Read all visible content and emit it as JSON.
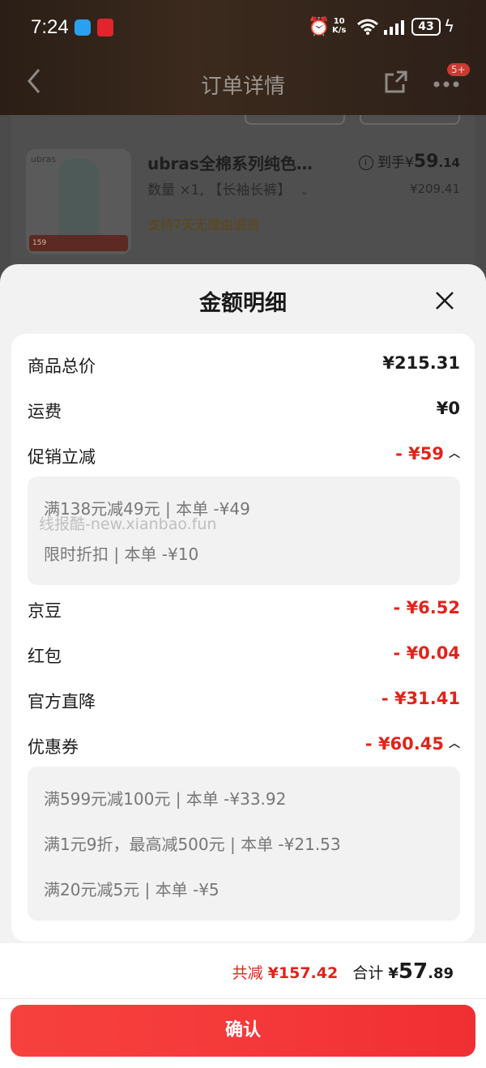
{
  "status_bar": {
    "time": "7:24",
    "speed_top": "10",
    "speed_bottom": "K/s",
    "battery": "43"
  },
  "nav": {
    "title": "订单详情",
    "badge": "5+"
  },
  "product": {
    "brand": "ubras",
    "name": "ubras全棉系列纯色…",
    "quantity": "数量 ×1, 【长袖长裤】",
    "return_policy": "支持7天无理由退货",
    "price_label": "到手¥",
    "price_int": "59",
    "price_dec": ".14",
    "original_price": "¥209.41",
    "thumb_promo": "159"
  },
  "sheet": {
    "title": "金额明细",
    "rows": [
      {
        "label": "商品总价",
        "value": "¥215.31"
      },
      {
        "label": "运费",
        "value": "¥0"
      },
      {
        "label": "促销立减",
        "value": "- ¥59"
      },
      {
        "label": "京豆",
        "value": "- ¥6.52"
      },
      {
        "label": "红包",
        "value": "- ¥0.04"
      },
      {
        "label": "官方直降",
        "value": "- ¥31.41"
      },
      {
        "label": "优惠券",
        "value": "- ¥60.45"
      }
    ],
    "promo_details": [
      "满138元减49元 | 本单 -¥49",
      "限时折扣 | 本单 -¥10"
    ],
    "coupon_details": [
      "满599元减100元 | 本单 -¥33.92",
      "满1元9折，最高减500元 | 本单 -¥21.53",
      "满20元减5元 | 本单 -¥5"
    ],
    "watermark": "线报酷-new.xianbao.fun"
  },
  "footer": {
    "saved_label": "共减",
    "saved_value": "¥157.42",
    "total_label": "合计",
    "total_currency": "¥",
    "total_int": "57",
    "total_dec": ".89",
    "confirm_label": "确认"
  },
  "colors": {
    "accent_red": "#e2231a",
    "button_red": "#f5393a"
  }
}
